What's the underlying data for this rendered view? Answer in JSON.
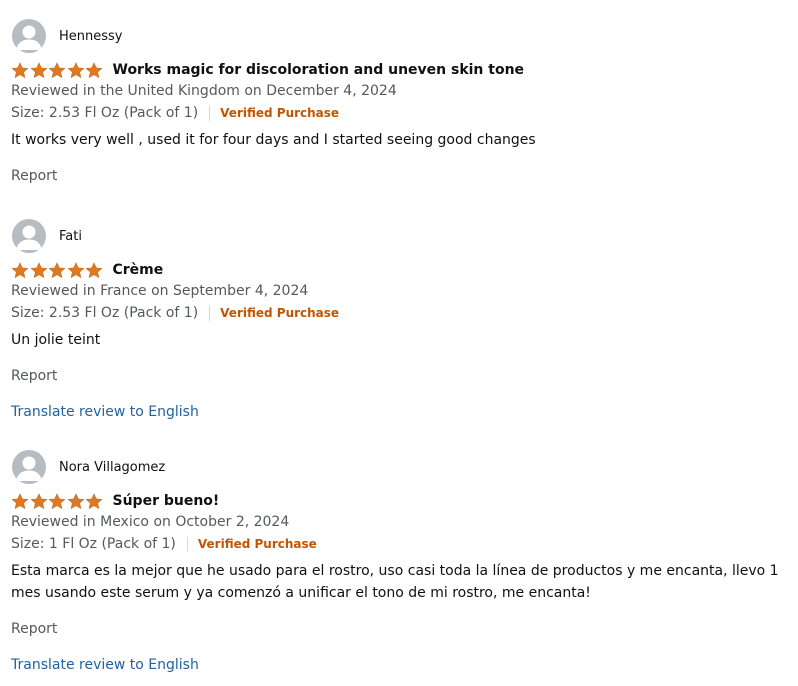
{
  "colors": {
    "star": "#de7921",
    "verified": "#c45500",
    "link": "#2162a1",
    "muted": "#565959",
    "text": "#0f1111"
  },
  "reviews": [
    {
      "author": "Hennessy",
      "rating": 5,
      "title": "Works magic for discoloration and uneven skin tone",
      "reviewed_in": "Reviewed in the United Kingdom on December 4, 2024",
      "size": "Size: 2.53 Fl Oz (Pack of 1)",
      "verified": "Verified Purchase",
      "body": "It works very well , used it for four days and I started seeing good changes",
      "report": "Report"
    },
    {
      "author": "Fati",
      "rating": 5,
      "title": "Crème",
      "reviewed_in": "Reviewed in France on September 4, 2024",
      "size": "Size: 2.53 Fl Oz (Pack of 1)",
      "verified": "Verified Purchase",
      "body": "Un jolie teint",
      "report": "Report",
      "translate": "Translate review to English"
    },
    {
      "author": "Nora Villagomez",
      "rating": 5,
      "title": "Súper bueno!",
      "reviewed_in": "Reviewed in Mexico on October 2, 2024",
      "size": "Size: 1 Fl Oz (Pack of 1)",
      "verified": "Verified Purchase",
      "body": "Esta marca es la mejor que he usado para el rostro, uso casi toda la línea de productos y me encanta, llevo 1 mes usando este serum y ya comenzó a unificar el tono de mi rostro, me encanta!",
      "report": "Report",
      "translate": "Translate review to English"
    }
  ]
}
